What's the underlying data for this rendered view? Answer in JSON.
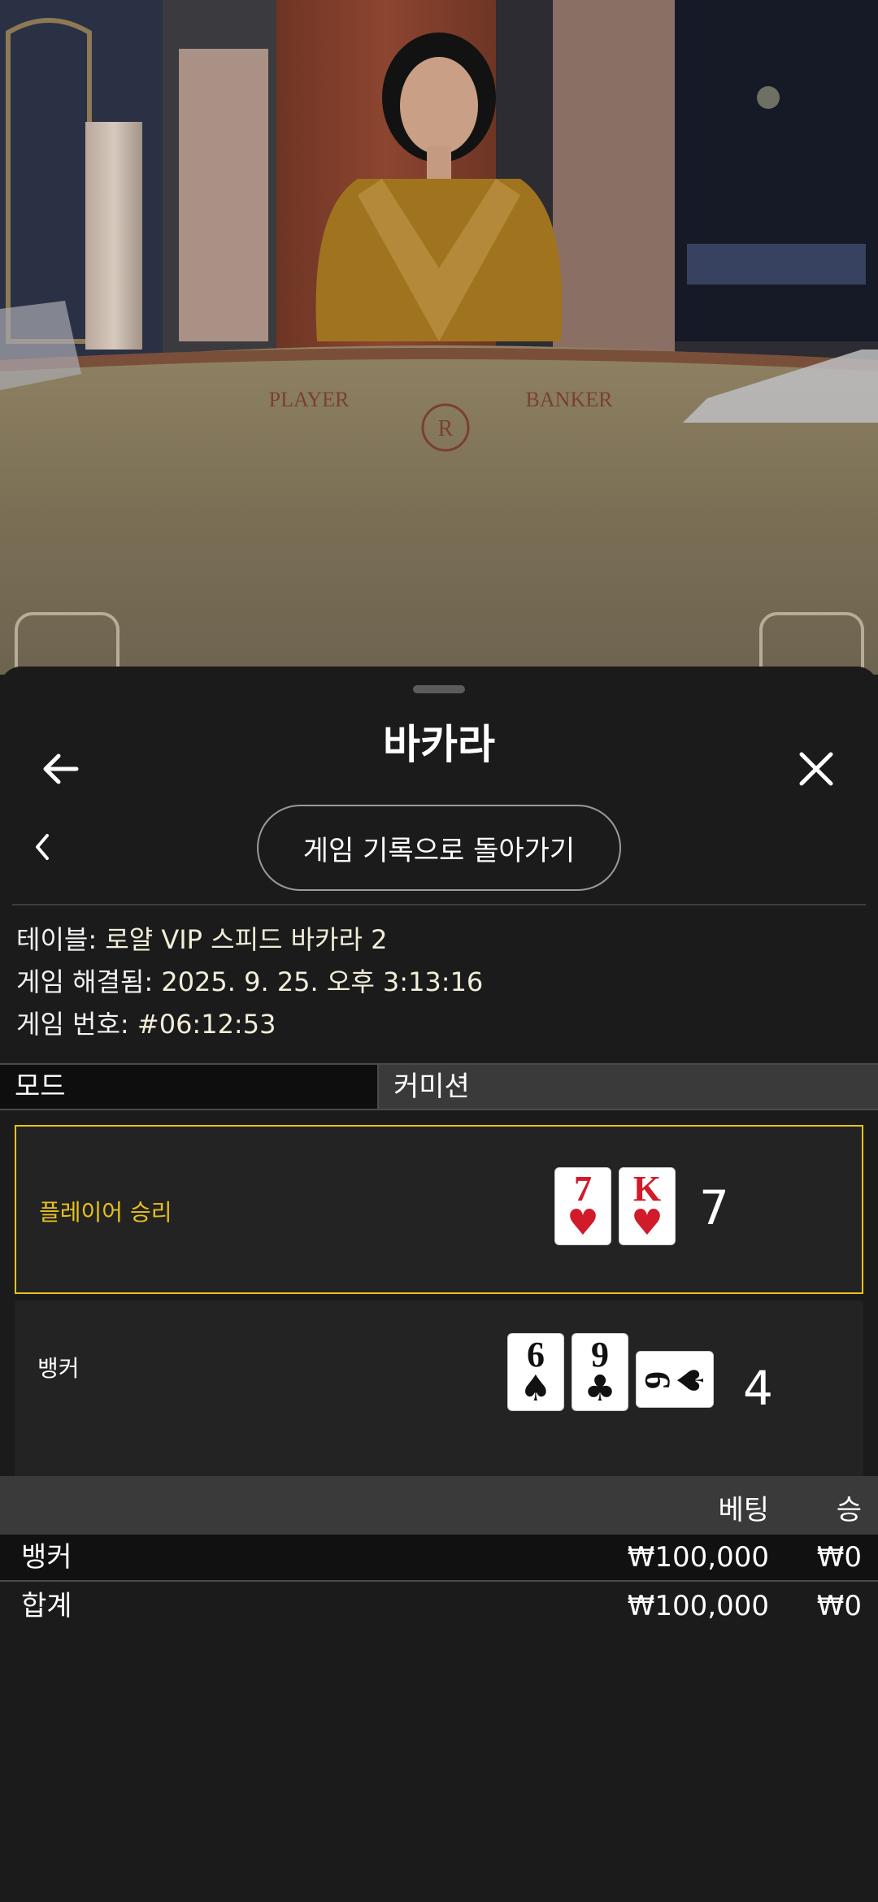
{
  "header": {
    "title": "바카라",
    "back_icon": "arrow-left-icon",
    "close_icon": "close-icon"
  },
  "history": {
    "prev_icon": "chevron-left-icon",
    "back_to_history_label": "게임 기록으로 돌아가기"
  },
  "game_info": {
    "table_label": "테이블:",
    "table_value": "로얄 VIP 스피드 바카라 2",
    "resolved_label": "게임 해결됨:",
    "resolved_value": "2025. 9. 25. 오후 3:13:16",
    "number_label": "게임 번호:",
    "number_value": "#06:12:53"
  },
  "mode_bar": {
    "mode_label": "모드",
    "commission_label": "커미션"
  },
  "hands": {
    "player": {
      "label": "플레이어 승리",
      "score": "7",
      "cards": [
        {
          "rank": "7",
          "suit": "♥",
          "color": "#d11a2a"
        },
        {
          "rank": "K",
          "suit": "♥",
          "color": "#d11a2a"
        }
      ]
    },
    "banker": {
      "label": "뱅커",
      "score": "4",
      "cards": [
        {
          "rank": "6",
          "suit": "♠",
          "color": "#111111"
        },
        {
          "rank": "9",
          "suit": "♣",
          "color": "#111111"
        },
        {
          "rank": "9",
          "suit": "♠",
          "color": "#111111",
          "rotated": true
        }
      ]
    }
  },
  "bets_table": {
    "col_bet": "베팅",
    "col_win": "승",
    "rows": [
      {
        "label": "뱅커",
        "bet": "₩100,000",
        "win": "₩0"
      }
    ],
    "total": {
      "label": "합계",
      "bet": "₩100,000",
      "win": "₩0"
    }
  },
  "video": {
    "table_text_player": "PLAYER",
    "table_text_banker": "BANKER"
  },
  "colors": {
    "accent_gold": "#e8c21a",
    "sheet_bg": "#1b1b1b"
  }
}
